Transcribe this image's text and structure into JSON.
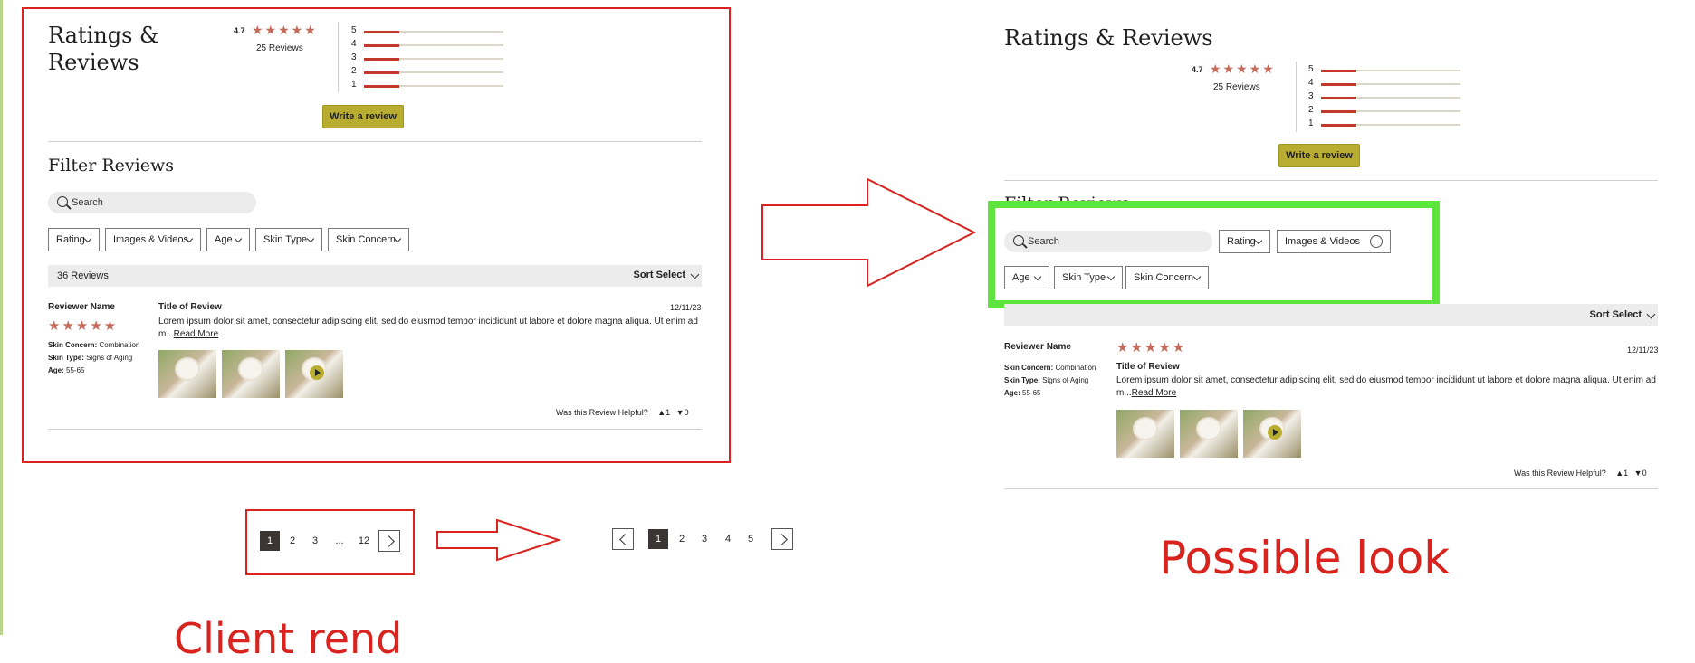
{
  "left": {
    "title_line1": "Ratings &",
    "title_line2": "Reviews",
    "avg_rating": "4.7",
    "stars": "★★★★★",
    "review_count": "25 Reviews",
    "distribution": [
      {
        "label": "5",
        "fraction": 0.25
      },
      {
        "label": "4",
        "fraction": 0.25
      },
      {
        "label": "3",
        "fraction": 0.25
      },
      {
        "label": "2",
        "fraction": 0.25
      },
      {
        "label": "1",
        "fraction": 0.25
      }
    ],
    "write_review": "Write a review",
    "filter_title": "Filter Reviews",
    "search_placeholder": "Search",
    "filters": [
      "Rating",
      "Images & Videos",
      "Age",
      "Skin Type",
      "Skin Concern"
    ],
    "count_label": "36 Reviews",
    "sort_label": "Sort Select",
    "review": {
      "reviewer": "Reviewer Name",
      "stars": "★★★★★",
      "skin_concern_label": "Skin Concern:",
      "skin_concern": "Combination",
      "skin_type_label": "Skin Type:",
      "skin_type": "Signs of Aging",
      "age_label": "Age:",
      "age": "55-65",
      "title": "Title of Review",
      "date": "12/11/23",
      "body": "Lorem ipsum dolor sit amet, consectetur adipiscing elit, sed do eiusmod tempor incididunt ut labore et dolore magna aliqua. Ut enim ad m...",
      "read_more": "Read More",
      "helpful_label": "Was this Review Helpful?",
      "up_count": "1",
      "down_count": "0"
    },
    "pagination": [
      "1",
      "2",
      "3",
      "...",
      "12"
    ]
  },
  "right": {
    "title": "Ratings & Reviews",
    "avg_rating": "4.7",
    "stars": "★★★★★",
    "review_count": "25 Reviews",
    "distribution": [
      {
        "label": "5",
        "fraction": 0.25
      },
      {
        "label": "4",
        "fraction": 0.25
      },
      {
        "label": "3",
        "fraction": 0.25
      },
      {
        "label": "2",
        "fraction": 0.25
      },
      {
        "label": "1",
        "fraction": 0.25
      }
    ],
    "write_review": "Write a review",
    "filter_title": "Filter Reviews",
    "search_placeholder": "Search",
    "filters_row1": [
      "Rating",
      "Images & Videos"
    ],
    "filters_row2": [
      "Age",
      "Skin Type",
      "Skin Concern"
    ],
    "sort_label": "Sort Select",
    "review": {
      "reviewer": "Reviewer Name",
      "stars": "★★★★★",
      "skin_concern_label": "Skin Concern:",
      "skin_concern": "Combination",
      "skin_type_label": "Skin Type:",
      "skin_type": "Signs of Aging",
      "age_label": "Age:",
      "age": "55-65",
      "title": "Title of Review",
      "date": "12/11/23",
      "body": "Lorem ipsum dolor sit amet, consectetur adipiscing elit, sed do eiusmod tempor incididunt ut labore et dolore magna aliqua. Ut enim ad m...",
      "read_more": "Read More",
      "helpful_label": "Was this Review Helpful?",
      "up_count": "1",
      "down_count": "0"
    },
    "pagination": [
      "1",
      "2",
      "3",
      "4",
      "5"
    ]
  },
  "annotations": {
    "possible_look": "Possible look",
    "client_caption": "Client rend"
  },
  "colors": {
    "annotation_red": "#d8231e",
    "highlight_green": "#5de43d",
    "star": "#c46a5b",
    "button": "#b9ad31"
  }
}
